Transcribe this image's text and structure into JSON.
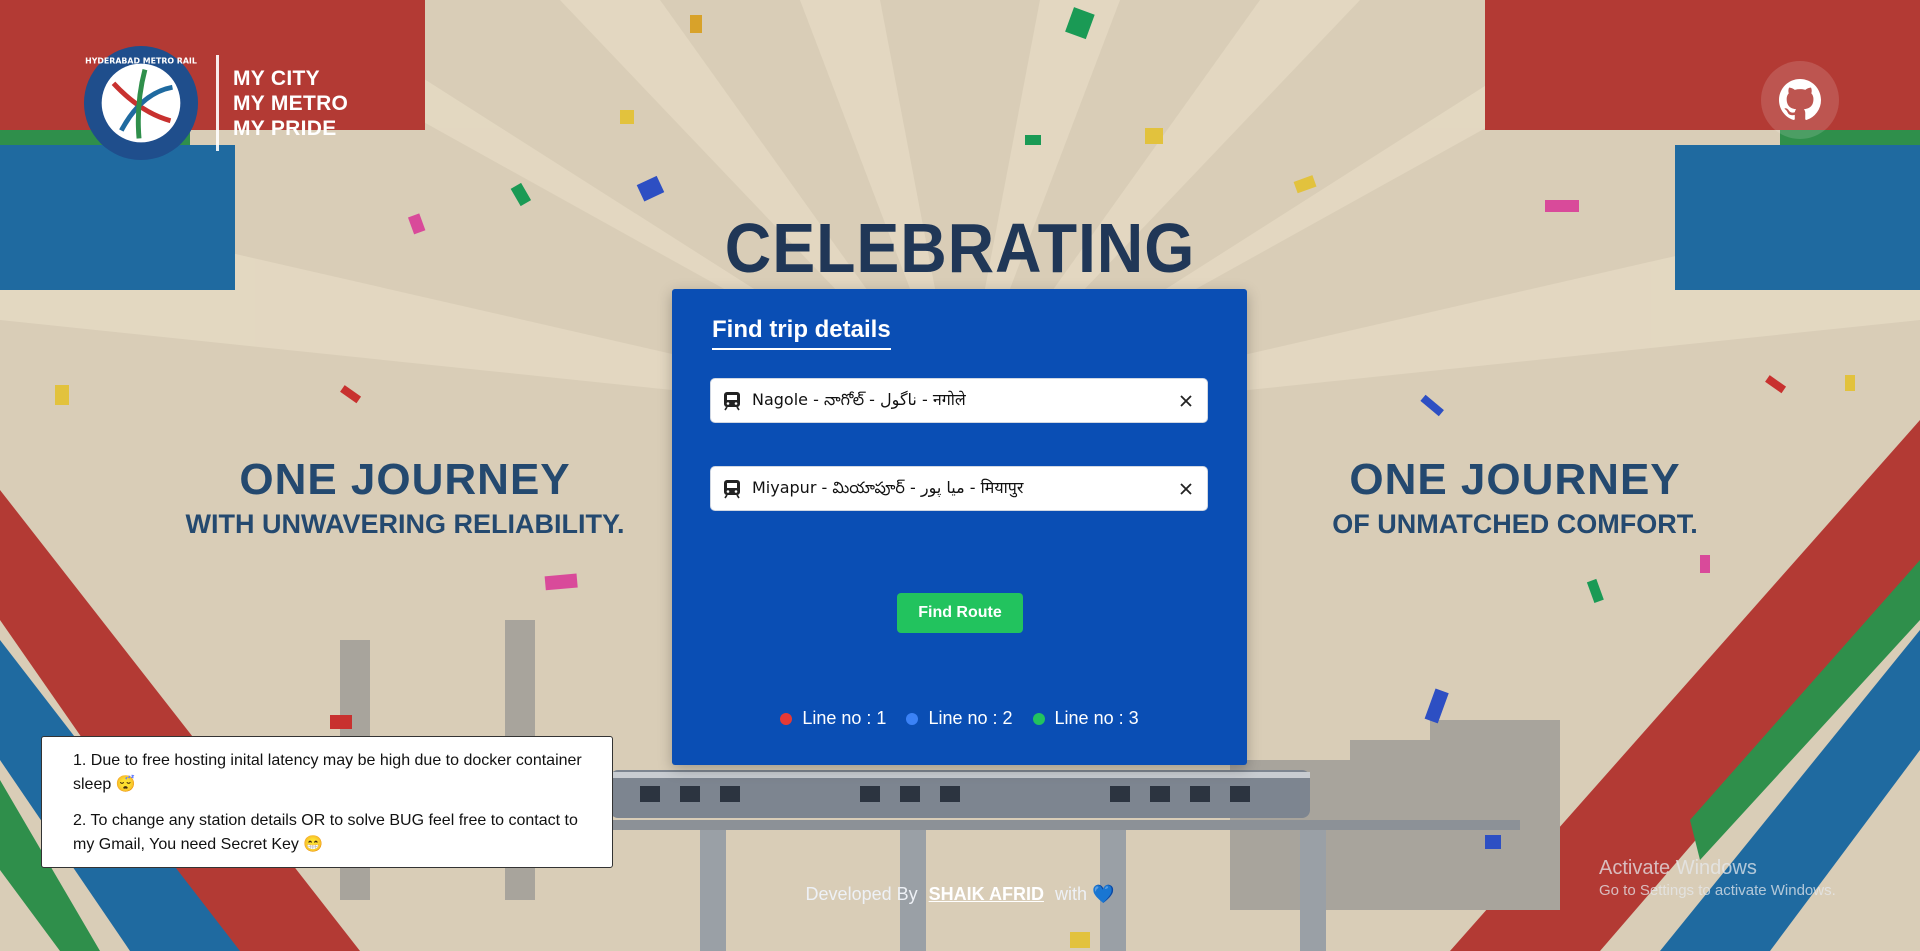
{
  "brand": {
    "badge_text": "HYDERABAD METRO RAIL",
    "slogan_lines": [
      "MY CITY",
      "MY METRO",
      "MY PRIDE"
    ]
  },
  "header": {
    "github_icon": "github-icon"
  },
  "banner": {
    "celebrating": "CELEBRATING",
    "left_big": "ONE JOURNEY",
    "left_small": "WITH UNWAVERING RELIABILITY.",
    "right_big": "ONE JOURNEY",
    "right_small": "OF UNMATCHED COMFORT."
  },
  "trip_form": {
    "title": "Find trip details",
    "source_value": "Nagole - నాగోల్ - ناگول - नगोले",
    "destination_value": "Miyapur - మియాపూర్ - میا پور - मियापुर",
    "find_button": "Find Route",
    "legend": [
      {
        "label": "Line no : 1",
        "color": "#e53935"
      },
      {
        "label": "Line no : 2",
        "color": "#3b82f6"
      },
      {
        "label": "Line no : 3",
        "color": "#22c35e"
      }
    ]
  },
  "notice": {
    "item1": "1. Due to free hosting inital latency may be high due to docker container sleep 😴",
    "item2": "2. To change any station details OR to solve BUG feel free to contact to my Gmail, You need Secret Key 😁"
  },
  "footer": {
    "prefix": "Developed By",
    "author": "SHAIK AFRID",
    "suffix": "with",
    "heart": "💙"
  },
  "watermark": {
    "title": "Activate Windows",
    "subtitle": "Go to Settings to activate Windows."
  },
  "colors": {
    "card": "#0a4eb4",
    "button": "#22c35e",
    "metro_red": "#c8312f",
    "metro_blue": "#1f6aa0",
    "metro_green": "#2e9a4a"
  }
}
